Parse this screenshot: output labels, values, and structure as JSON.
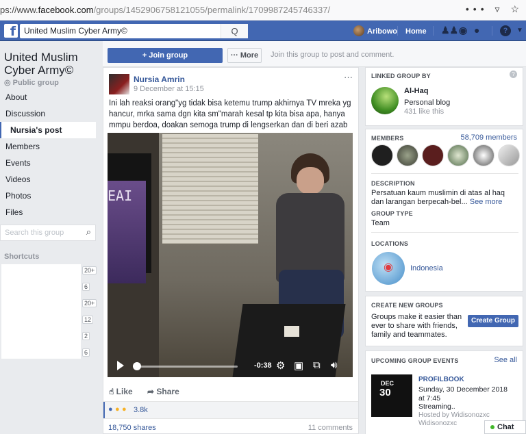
{
  "browser": {
    "url_prefix": "ps://www.",
    "url_domain": "facebook.com",
    "url_path": "/groups/1452906758121055/permalink/1709987245746337/",
    "menu_glyph": "•••",
    "pocket_icon": "pocket-icon",
    "star_icon": "star-icon"
  },
  "fbbar": {
    "logo": "f",
    "search_value": "United Muslim Cyber Army©",
    "search_icon": "Q",
    "user_name": "Aribowo",
    "home_label": "Home",
    "help_glyph": "?"
  },
  "group": {
    "name": "United Muslim Cyber Army©",
    "type": "Public group",
    "nav": [
      "About",
      "Discussion",
      "Nursia's post",
      "Members",
      "Events",
      "Videos",
      "Photos",
      "Files"
    ],
    "search_placeholder": "Search this group",
    "shortcuts_label": "Shortcuts",
    "shortcut_badges": [
      "20+",
      "6",
      "20+",
      "12",
      "2",
      "6"
    ]
  },
  "topbar": {
    "join_label": "+ Join group",
    "more_label": "··· More",
    "join_text": "Join this group to post and comment."
  },
  "post": {
    "author": "Nursia Amrin",
    "date": "9 December at 15:15",
    "more_glyph": "···",
    "text": "Ini lah reaksi orang\"yg tidak bisa ketemu trump akhirnya TV mreka yg hancur, mrka sama dgn kita sm\"marah kesal tp kita bisa apa, hanya mmpu berdoa, doakan semoga trump di lengserkan dan di beri azab",
    "video": {
      "tv_text": "EAI",
      "time": "-0:38",
      "progress": 0.02
    },
    "like_label": "Like",
    "share_label": "Share",
    "reaction_count": "3.8k",
    "shares": "18,750 shares",
    "comments": "11 comments"
  },
  "right": {
    "linked": {
      "header": "LINKED GROUP BY",
      "name": "Al-Haq",
      "kind": "Personal blog",
      "likes": "431 like this"
    },
    "members": {
      "header": "MEMBERS",
      "count": "58,709 members",
      "desc_header": "DESCRIPTION",
      "desc": "Persatuan kaum muslimin di atas al haq dan larangan berpecah-bel...",
      "see_more": "See more",
      "type_header": "GROUP TYPE",
      "type": "Team",
      "loc_header": "LOCATIONS",
      "location": "Indonesia"
    },
    "create": {
      "header": "CREATE NEW GROUPS",
      "text": "Groups make it easier than ever to share with friends, family and teammates.",
      "button": "Create Group"
    },
    "events": {
      "header": "UPCOMING GROUP EVENTS",
      "see_all": "See all",
      "month": "DEC",
      "day": "30",
      "name": "PROFILBOOK",
      "date": "Sunday, 30 December 2018 at 7:45",
      "status": "Streaming..",
      "host": "Hosted by Widisonozxc",
      "host2": "Widisonozxc"
    }
  },
  "chat_label": "Chat"
}
